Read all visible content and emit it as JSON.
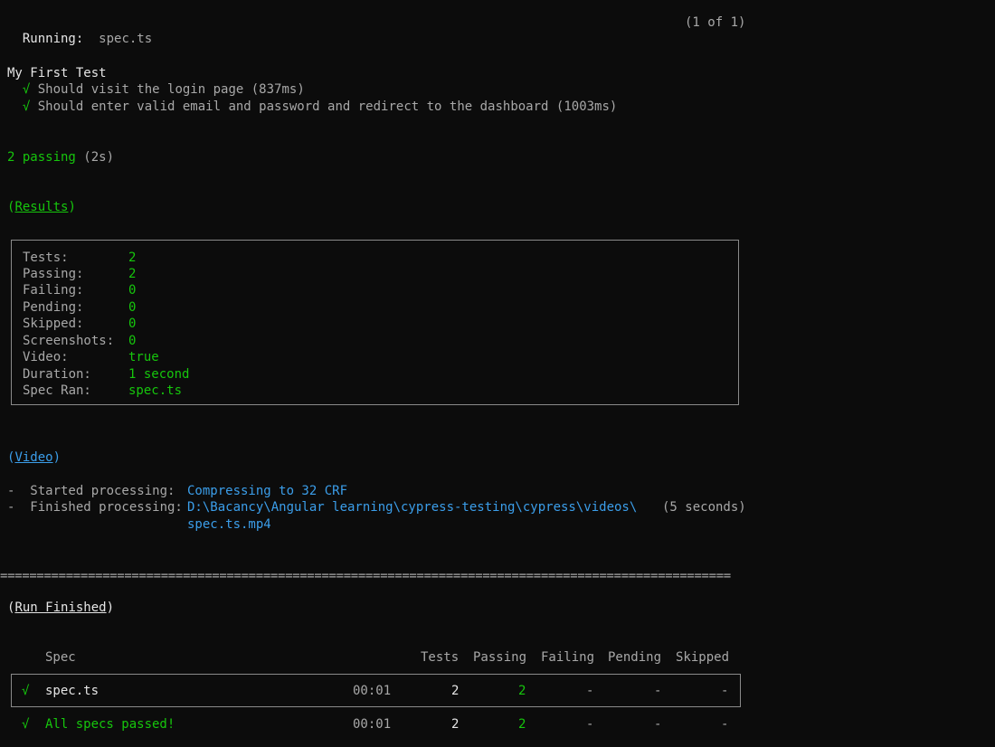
{
  "header": {
    "running_label": "Running:",
    "spec_name": "spec.ts",
    "counter": "(1 of 1)"
  },
  "suite": {
    "title": "My First Test",
    "check_symbol": "√",
    "tests": [
      {
        "title": "Should visit the login page",
        "duration": "(837ms)"
      },
      {
        "title": "Should enter valid email and password and redirect to the dashboard",
        "duration": "(1003ms)"
      }
    ]
  },
  "summary": {
    "passing_text": "2 passing",
    "passing_time": "(2s)"
  },
  "results": {
    "heading": "Results",
    "rows": [
      {
        "label": "Tests:",
        "value": "2"
      },
      {
        "label": "Passing:",
        "value": "2"
      },
      {
        "label": "Failing:",
        "value": "0"
      },
      {
        "label": "Pending:",
        "value": "0"
      },
      {
        "label": "Skipped:",
        "value": "0"
      },
      {
        "label": "Screenshots:",
        "value": "0"
      },
      {
        "label": "Video:",
        "value": "true"
      },
      {
        "label": "Duration:",
        "value": "1 second"
      },
      {
        "label": "Spec Ran:",
        "value": "spec.ts"
      }
    ]
  },
  "video": {
    "heading": "Video",
    "started_label": "-  Started processing:",
    "started_value": "Compressing to 32 CRF",
    "finished_label": "-  Finished processing:",
    "finished_path_1": "D:\\Bacancy\\Angular learning\\cypress-testing\\cypress\\videos\\",
    "finished_path_2": "spec.ts.mp4",
    "finished_time": "(5 seconds)"
  },
  "separator": "====================================================================================================",
  "run_finished": {
    "heading": "Run Finished",
    "columns": {
      "spec": "Spec",
      "tests": "Tests",
      "passing": "Passing",
      "failing": "Failing",
      "pending": "Pending",
      "skipped": "Skipped"
    },
    "spec_row": {
      "check": "√",
      "name": "spec.ts",
      "duration": "00:01",
      "tests": "2",
      "passing": "2",
      "failing": "-",
      "pending": "-",
      "skipped": "-"
    },
    "total_row": {
      "check": "√",
      "name": "All specs passed!",
      "duration": "00:01",
      "tests": "2",
      "passing": "2",
      "failing": "-",
      "pending": "-",
      "skipped": "-"
    }
  },
  "colors": {
    "background": "#0c0c0c",
    "text": "#cccccc",
    "green": "#16c60c",
    "blue": "#3b9eea"
  }
}
